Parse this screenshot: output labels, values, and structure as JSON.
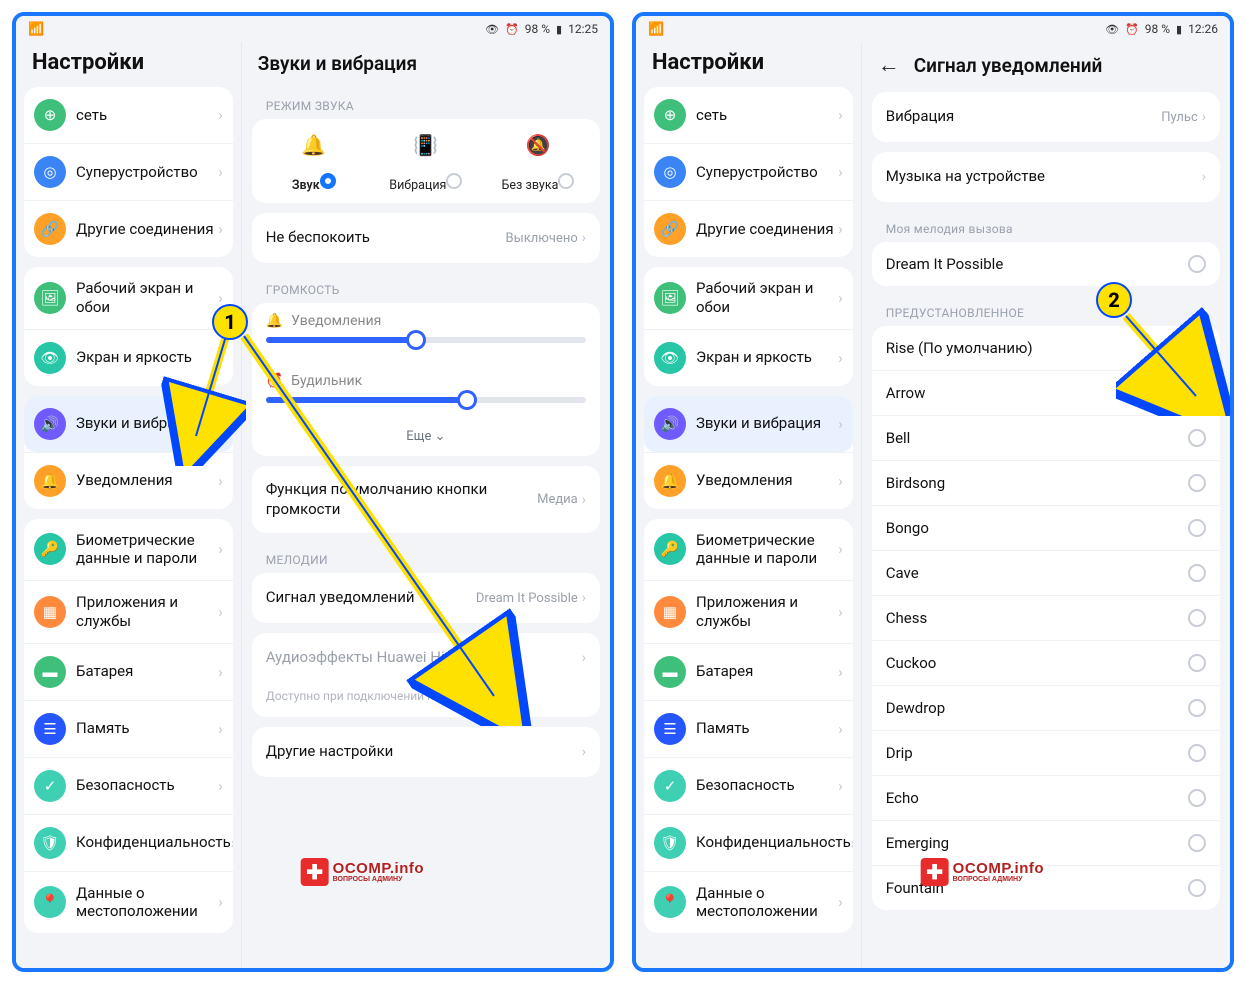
{
  "status": {
    "battery": "98 %",
    "time1": "12:25",
    "time2": "12:26"
  },
  "sidebar": {
    "title": "Настройки",
    "items": [
      {
        "label": "сеть"
      },
      {
        "label": "Суперустройство"
      },
      {
        "label": "Другие соединения"
      },
      {
        "label": "Рабочий экран и обои"
      },
      {
        "label": "Экран и яркость"
      },
      {
        "label": "Звуки и вибрация"
      },
      {
        "label": "Уведомления"
      },
      {
        "label": "Биометрические данные и пароли"
      },
      {
        "label": "Приложения и службы"
      },
      {
        "label": "Батарея"
      },
      {
        "label": "Память"
      },
      {
        "label": "Безопасность"
      },
      {
        "label": "Конфиденциальность"
      },
      {
        "label": "Данные о местоположении"
      }
    ]
  },
  "left": {
    "title": "Звуки и вибрация",
    "sec_mode": "РЕЖИМ ЗВУКА",
    "modes": [
      {
        "label": "Звук"
      },
      {
        "label": "Вибрация"
      },
      {
        "label": "Без звука"
      }
    ],
    "dnd_label": "Не беспокоить",
    "dnd_value": "Выключено",
    "sec_volume": "ГРОМКОСТЬ",
    "slider_notif": "Уведомления",
    "slider_alarm": "Будильник",
    "more": "Еще",
    "default_fn": "Функция по умолчанию кнопки громкости",
    "default_fn_val": "Медиа",
    "sec_melodies": "МЕЛОДИИ",
    "notif_signal": "Сигнал уведомлений",
    "notif_signal_val": "Dream It Possible",
    "histen": "Аудиоэффекты Huawei Histen",
    "histen_hint": "Доступно при подключении наушников",
    "other": "Другие настройки"
  },
  "right": {
    "title": "Сигнал уведомлений",
    "vibration": "Вибрация",
    "vibration_val": "Пульс",
    "device_music": "Музыка на устройстве",
    "sec_mymelody": "Моя мелодия вызова",
    "my_melody": "Dream It Possible",
    "sec_preset": "ПРЕДУСТАНОВЛЕННОЕ",
    "presets": [
      "Rise (По умолчанию)",
      "Arrow",
      "Bell",
      "Birdsong",
      "Bongo",
      "Cave",
      "Chess",
      "Cuckoo",
      "Dewdrop",
      "Drip",
      "Echo",
      "Emerging",
      "Fountain"
    ]
  },
  "watermark": {
    "main": "OCOMP.info",
    "sub": "ВОПРОСЫ АДМИНУ"
  },
  "badges": {
    "one": "1",
    "two": "2"
  }
}
